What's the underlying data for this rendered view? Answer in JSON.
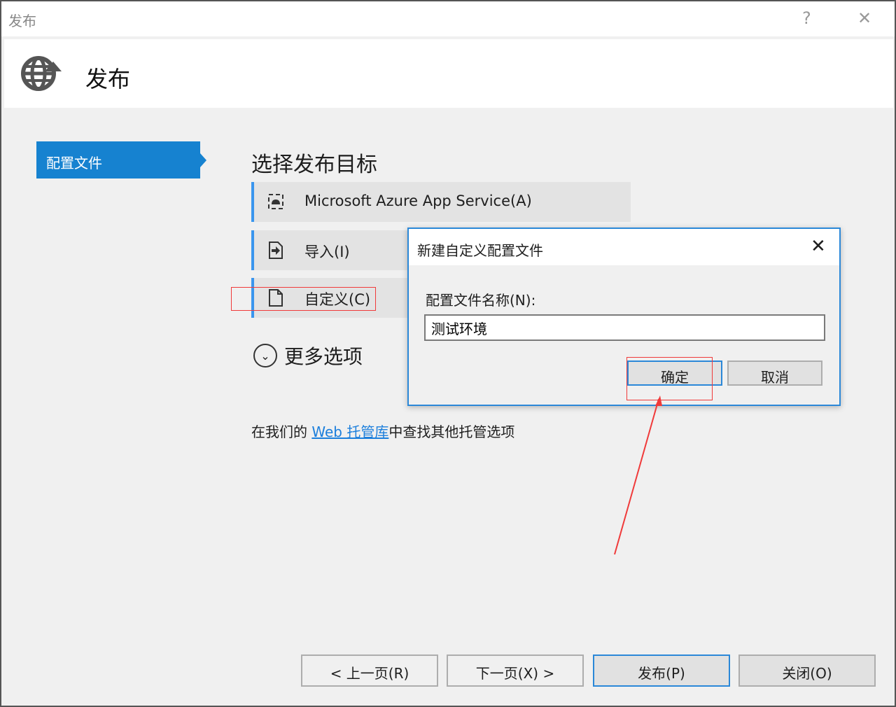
{
  "window": {
    "title": "发布",
    "help": "?",
    "close": "✕"
  },
  "header": {
    "title": "发布",
    "icon": "globe-publish-icon"
  },
  "sidebar": {
    "items": [
      {
        "label": "配置文件"
      }
    ]
  },
  "main": {
    "heading": "选择发布目标",
    "targets": [
      {
        "label": "Microsoft Azure App Service(A)",
        "icon": "azure-app-service-icon"
      },
      {
        "label": "导入(I)",
        "icon": "import-icon"
      },
      {
        "label": "自定义(C)",
        "icon": "file-icon"
      }
    ],
    "more_options": "更多选项",
    "find_prefix": "在我们的 ",
    "find_link": "Web 托管库",
    "find_suffix": "中查找其他托管选项"
  },
  "dialog": {
    "title": "新建自定义配置文件",
    "close": "✕",
    "field_label": "配置文件名称(N):",
    "field_value": "测试环境",
    "ok": "确定",
    "cancel": "取消"
  },
  "footer": {
    "prev": "< 上一页(R)",
    "next": "下一页(X) >",
    "publish": "发布(P)",
    "close": "关闭(O)"
  },
  "colors": {
    "accent": "#1682d0",
    "annotation": "#f03a3a"
  }
}
